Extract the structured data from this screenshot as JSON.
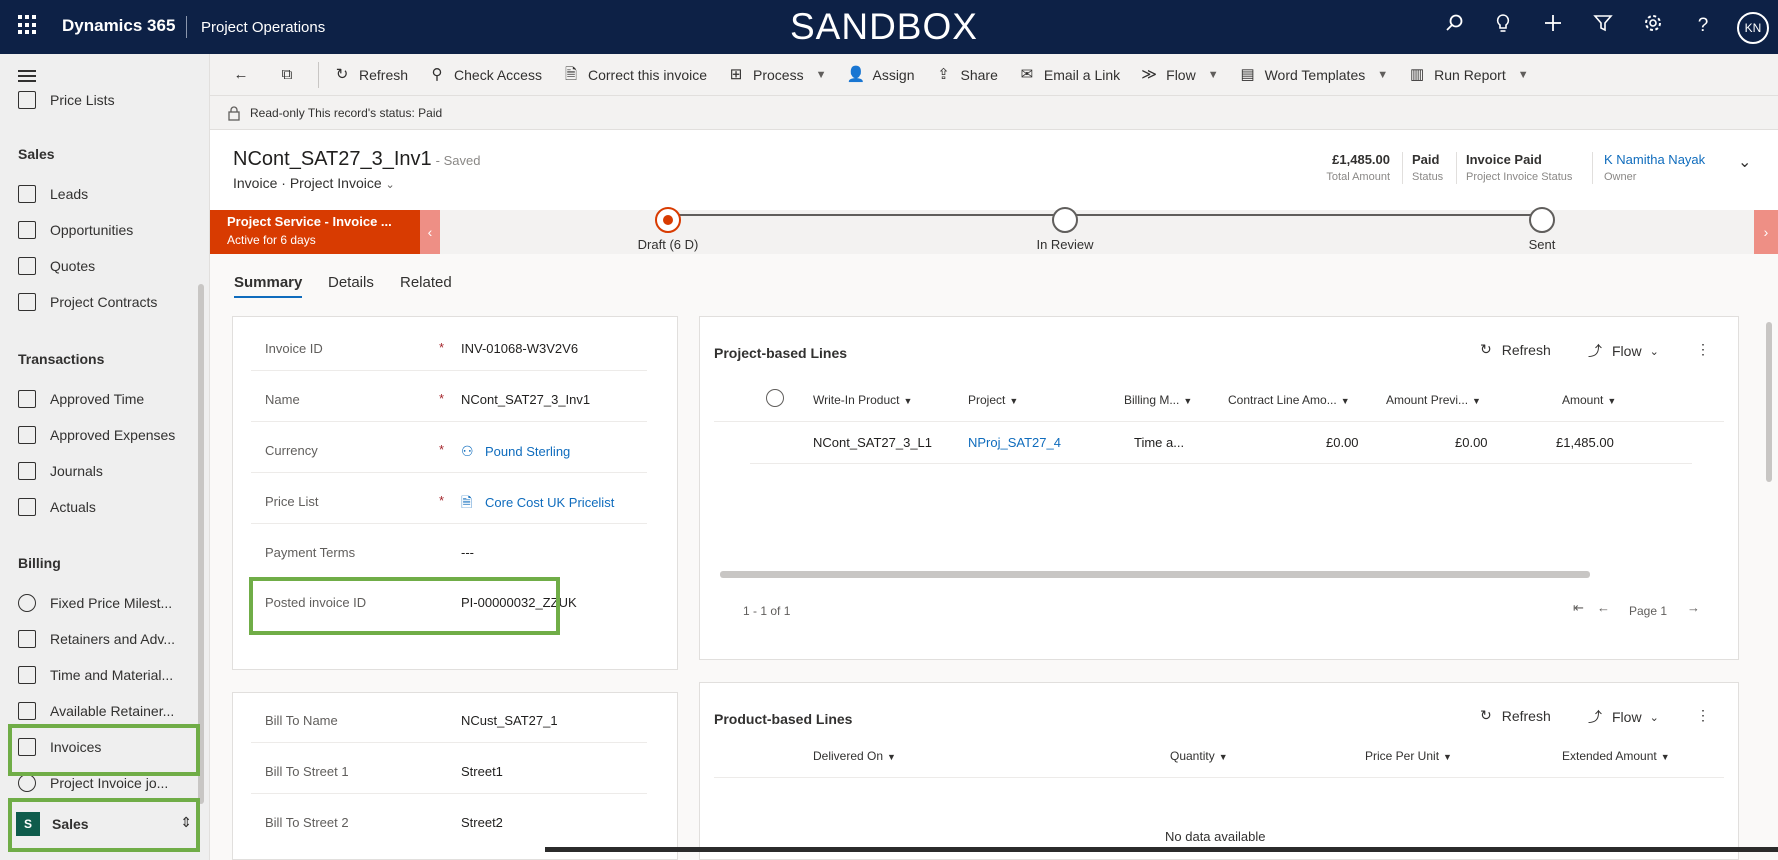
{
  "topbar": {
    "brand": "Dynamics 365",
    "app": "Project Operations",
    "environment": "SANDBOX",
    "icons": [
      "search-icon",
      "lightbulb-icon",
      "plus-icon",
      "filter-icon",
      "gear-icon",
      "help-icon"
    ],
    "avatar_initials": "KN"
  },
  "sidebar": {
    "partial_item": "Price Lists",
    "groups": [
      {
        "heading": "Sales",
        "items": [
          "Leads",
          "Opportunities",
          "Quotes",
          "Project Contracts"
        ]
      },
      {
        "heading": "Transactions",
        "items": [
          "Approved Time",
          "Approved Expenses",
          "Journals",
          "Actuals"
        ]
      },
      {
        "heading": "Billing",
        "items": [
          "Fixed Price Milest...",
          "Retainers and Adv...",
          "Time and Material...",
          "Available Retainer...",
          "Invoices",
          "Project Invoice jo..."
        ]
      }
    ],
    "area": {
      "badge": "S",
      "label": "Sales"
    }
  },
  "commands": {
    "refresh": "Refresh",
    "check_access": "Check Access",
    "correct_invoice": "Correct this invoice",
    "process": "Process",
    "assign": "Assign",
    "share": "Share",
    "email_link": "Email a Link",
    "flow": "Flow",
    "word_templates": "Word Templates",
    "run_report": "Run Report"
  },
  "notice": "Read-only This record's status: Paid",
  "header": {
    "title": "NCont_SAT27_3_Inv1",
    "saved": "- Saved",
    "entity": "Invoice",
    "form": "Project Invoice",
    "fields": [
      {
        "value": "£1,485.00",
        "label": "Total Amount"
      },
      {
        "value": "Paid",
        "label": "Status"
      },
      {
        "value": "Invoice Paid",
        "label": "Project Invoice Status"
      },
      {
        "value": "K Namitha Nayak",
        "label": "Owner"
      }
    ]
  },
  "bpf": {
    "active_title": "Project Service - Invoice ...",
    "active_sub": "Active for 6 days",
    "stages": [
      "Draft  (6 D)",
      "In Review",
      "Sent"
    ]
  },
  "tabs": [
    "Summary",
    "Details",
    "Related"
  ],
  "summary_fields": [
    {
      "label": "Invoice ID",
      "value": "INV-01068-W3V2V6"
    },
    {
      "label": "Name",
      "value": "NCont_SAT27_3_Inv1"
    },
    {
      "label": "Currency",
      "value": "Pound Sterling"
    },
    {
      "label": "Price List",
      "value": "Core Cost UK Pricelist"
    },
    {
      "label": "Payment Terms",
      "value": "---"
    },
    {
      "label": "Posted invoice ID",
      "value": "PI-00000032_ZZUK"
    }
  ],
  "required_mark": "*",
  "bill_fields": [
    {
      "label": "Bill To Name",
      "value": "NCust_SAT27_1"
    },
    {
      "label": "Bill To Street 1",
      "value": "Street1"
    },
    {
      "label": "Bill To Street 2",
      "value": "Street2"
    }
  ],
  "project_lines": {
    "title": "Project-based Lines",
    "refresh": "Refresh",
    "flow": "Flow",
    "columns": [
      "Write-In Product",
      "Project",
      "Billing M...",
      "Contract Line Amo...",
      "Amount Previ...",
      "Amount"
    ],
    "row": [
      "NCont_SAT27_3_L1",
      "NProj_SAT27_4",
      "Time a...",
      "£0.00",
      "£0.00",
      "£1,485.00"
    ],
    "count": "1 - 1 of 1",
    "page": "Page 1"
  },
  "product_lines": {
    "title": "Product-based Lines",
    "refresh": "Refresh",
    "flow": "Flow",
    "columns": [
      "Delivered On",
      "Quantity",
      "Price Per Unit",
      "Extended Amount"
    ],
    "empty": "No data available"
  },
  "colors": {
    "topbar": "#0d2146",
    "accent": "#d83b01",
    "link": "#0f6cbd",
    "highlight": "#70ad47"
  }
}
